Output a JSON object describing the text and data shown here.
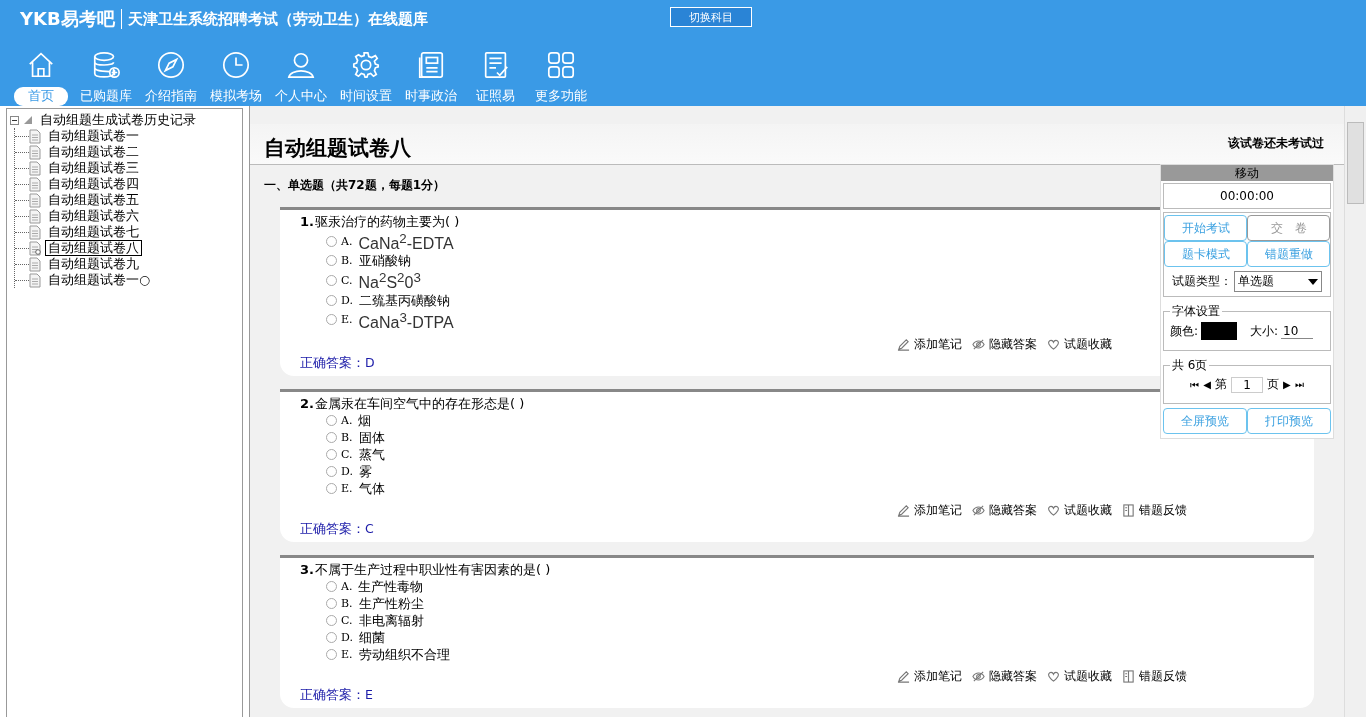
{
  "header": {
    "brand": "YKB易考吧",
    "title": "天津卫生系统招聘考试（劳动卫生）在线题库",
    "switch_button": "切换科目"
  },
  "nav": [
    {
      "label": "首页",
      "selected": true
    },
    {
      "label": "已购题库",
      "selected": false
    },
    {
      "label": "介绍指南",
      "selected": false
    },
    {
      "label": "模拟考场",
      "selected": false
    },
    {
      "label": "个人中心",
      "selected": false
    },
    {
      "label": "时间设置",
      "selected": false
    },
    {
      "label": "时事政治",
      "selected": false
    },
    {
      "label": "证照易",
      "selected": false
    },
    {
      "label": "更多功能",
      "selected": false
    }
  ],
  "tree": {
    "label": "自动组题生成试卷历史记录",
    "expanded": true,
    "children": [
      {
        "label": "自动组题试卷一",
        "selected": false
      },
      {
        "label": "自动组题试卷二",
        "selected": false
      },
      {
        "label": "自动组题试卷三",
        "selected": false
      },
      {
        "label": "自动组题试卷四",
        "selected": false
      },
      {
        "label": "自动组题试卷五",
        "selected": false
      },
      {
        "label": "自动组题试卷六",
        "selected": false
      },
      {
        "label": "自动组题试卷七",
        "selected": false
      },
      {
        "label": "自动组题试卷八",
        "selected": true
      },
      {
        "label": "自动组题试卷九",
        "selected": false
      },
      {
        "label": "自动组题试卷一○",
        "selected": false
      }
    ]
  },
  "paper": {
    "title": "自动组题试卷八",
    "status": "该试卷还未考试过",
    "section": "一、单选题（共72题，每题1分）"
  },
  "questions": [
    {
      "number": "1.",
      "text": "驱汞治疗的药物主要为( )",
      "options": [
        {
          "letter": "A.",
          "text": "CaNa$^{2}$-EDTA",
          "kind": "formula",
          "selected": false
        },
        {
          "letter": "B.",
          "text": "亚硝酸钠",
          "kind": "text",
          "selected": false
        },
        {
          "letter": "C.",
          "text": "Na$^{2}$S$^{2}$0$^{3}$",
          "kind": "formula",
          "selected": false
        },
        {
          "letter": "D.",
          "text": "二巯基丙磺酸钠",
          "kind": "text",
          "selected": false
        },
        {
          "letter": "E.",
          "text": "CaNa$^{3}$-DTPA",
          "kind": "formula",
          "selected": false
        }
      ],
      "actions": [
        {
          "label": "添加笔记"
        },
        {
          "label": "隐藏答案"
        },
        {
          "label": "试题收藏"
        }
      ],
      "answer_label": "正确答案：",
      "answer": "D"
    },
    {
      "number": "2.",
      "text": "金属汞在车间空气中的存在形态是( )",
      "options": [
        {
          "letter": "A.",
          "text": "烟",
          "kind": "text",
          "selected": false
        },
        {
          "letter": "B.",
          "text": "固体",
          "kind": "text",
          "selected": false
        },
        {
          "letter": "C.",
          "text": "蒸气",
          "kind": "text",
          "selected": false
        },
        {
          "letter": "D.",
          "text": "雾",
          "kind": "text",
          "selected": false
        },
        {
          "letter": "E.",
          "text": "气体",
          "kind": "text",
          "selected": false
        }
      ],
      "actions": [
        {
          "label": "添加笔记"
        },
        {
          "label": "隐藏答案"
        },
        {
          "label": "试题收藏"
        },
        {
          "label": "错题反馈"
        }
      ],
      "answer_label": "正确答案：",
      "answer": "C"
    },
    {
      "number": "3.",
      "text": "不属于生产过程中职业性有害因素的是( )",
      "options": [
        {
          "letter": "A.",
          "text": "生产性毒物",
          "kind": "text",
          "selected": false
        },
        {
          "letter": "B.",
          "text": "生产性粉尘",
          "kind": "text",
          "selected": false
        },
        {
          "letter": "C.",
          "text": "非电离辐射",
          "kind": "text",
          "selected": false
        },
        {
          "letter": "D.",
          "text": "细菌",
          "kind": "text",
          "selected": false
        },
        {
          "letter": "E.",
          "text": "劳动组织不合理",
          "kind": "text",
          "selected": false
        }
      ],
      "actions": [
        {
          "label": "添加笔记"
        },
        {
          "label": "隐藏答案"
        },
        {
          "label": "试题收藏"
        },
        {
          "label": "错题反馈"
        }
      ],
      "answer_label": "正确答案：",
      "answer": "E"
    }
  ],
  "panel": {
    "handle": "移动",
    "timer": "00:00:00",
    "buttons": [
      {
        "label": "开始考试",
        "disabled": false
      },
      {
        "label": "交　卷",
        "disabled": true
      },
      {
        "label": "题卡模式",
        "disabled": false
      },
      {
        "label": "错题重做",
        "disabled": false
      }
    ],
    "type_label": "试题类型：",
    "type_value": "单选题",
    "font_group": "字体设置",
    "color_label": "颜色:",
    "color": "#000000",
    "size_label": "大小:",
    "size_value": "10",
    "page_group": "共 6页",
    "page_prefix": "第",
    "page_value": "1",
    "page_suffix": "页",
    "first": "⏮",
    "prev": "◀",
    "next": "▶",
    "last": "⏭",
    "bottom_buttons": [
      {
        "label": "全屏预览"
      },
      {
        "label": "打印预览"
      }
    ]
  }
}
